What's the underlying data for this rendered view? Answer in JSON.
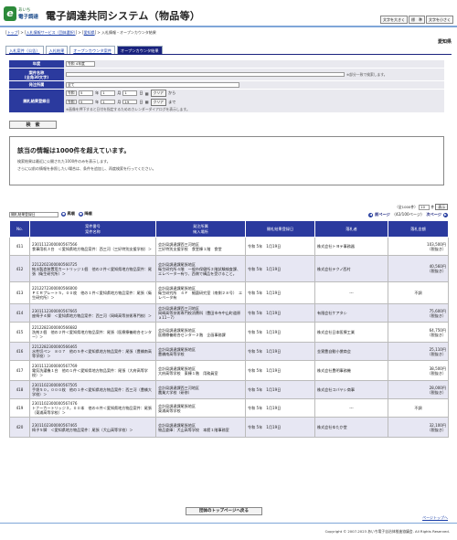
{
  "header": {
    "logo_top": "あいち",
    "logo_bottom": "電子調達",
    "title": "電子調達共同システム（物品等）",
    "font_buttons": [
      "文字を大きく",
      "標　準",
      "文字を小さく"
    ]
  },
  "breadcrumb": {
    "items": [
      "トップ",
      "入札情報サービス（団体選択）",
      "愛知県"
    ],
    "current": "入札情報・オープンカウンタ結果"
  },
  "region": "愛知県",
  "tabs": [
    "入札案件（公告）",
    "入札結果",
    "オープンカウンタ案件",
    "オープンカウンタ結果"
  ],
  "form": {
    "year_label": "年度",
    "year_value": "令和 4年度",
    "case_label": "案件名称\n(全角30文字)",
    "case_note": "※部分一致で検索します。",
    "org_label": "発注所属",
    "org_value": "全て",
    "date_label": "開札結果登録日",
    "date_from": [
      "令和",
      "5",
      "1",
      "1"
    ],
    "date_to": [
      "令和",
      "5",
      "1",
      "19"
    ],
    "date_units": [
      "年",
      "月",
      "日"
    ],
    "clear": "クリア",
    "from_suffix": "から",
    "to_suffix": "まで",
    "cal_note": "※画像を押下すると日付を指定するためのカレンダーダイアログを表示します。",
    "search_button": "検　索"
  },
  "message": {
    "title": "該当の情報は1000件を超えています。",
    "line1": "検索結果は最近に公開された1000件のみを表示します。",
    "line2": "さらに以前の情報を参照したい場合は、条件を追加し、再度検索を行ってください。"
  },
  "controls": {
    "total": "（全1000件）",
    "per_page": "10",
    "per_page_unit": "件",
    "display": "表示",
    "sort_value": "開札結果登録日",
    "asc": "昇順",
    "desc": "降順",
    "prev": "前ページ",
    "page_info": "（42/100ページ）",
    "next": "次ページ"
  },
  "table": {
    "headers": [
      "No.",
      "案件番号\n案件名称",
      "発注所属\n納入場所",
      "開札結果登録日",
      "落札者",
      "落札金額"
    ],
    "rows": [
      {
        "no": "411",
        "num": "2301112300000567566",
        "name": "食事用机３台　＜愛知県地方物品案件：西三河（三好特別支援学校）＞",
        "org": "会計局調達課西三河地区\n三好特別支援学校　食堂棟１階　食堂",
        "date": "令和 5年　1月19日",
        "winner": "株式会社トヨテ事務器",
        "price": "103,500円",
        "tax": "（税抜き）"
      },
      {
        "no": "412",
        "num": "2212202300000560725",
        "name": "純水製造装置用カートリッジ１個　他の２件＜愛知県地方物品案件：尾張（衛生研究所）＞",
        "org": "会計局調達課尾張地区\n衛生研究所４階　一般市保健所２階試験検査課、エレベーター有り、西側で構品を受けること。",
        "date": "令和 5年　1月19日",
        "winner": "株式会社テクノ西村",
        "price": "40,560円",
        "tax": "（税抜き）"
      },
      {
        "no": "413",
        "num": "2212272300000566000",
        "name": "ＰＣＲプレート５，００枚　他の１件＜愛知県地方物品案件：尾張（衛生研究所）＞",
        "org": "会計局調達課尾張地区\n衛生研究所　４Ｆ　細菌研究室（南側２８号）　エレベータ有",
        "date": "令和 5年　1月19日",
        "winner": "---",
        "price": "不調",
        "tax": ""
      },
      {
        "no": "414",
        "num": "2301112300000567665",
        "name": "座椅子４脚　＜愛知県地方物品案件：西三河（岡崎高等技術専門校）＞",
        "org": "会計局調達課西三河地区\n岡崎高等技術専門校消費科（豊田市寺中山町道原ａ11－7）",
        "date": "令和 5年　1月19日",
        "winner": "有限会社ケアタシ",
        "price": "75,600円",
        "tax": "（税抜き）"
      },
      {
        "no": "415",
        "num": "2212282300000566682",
        "name": "洗剤２個　他の２件＜愛知県地方物品案件：尾張（医療療養総合センター）＞",
        "org": "会計局調達課尾張地区\n医療療養総合センター２階　企画事務課",
        "date": "令和 5年　1月19日",
        "winner": "株式会社日本医療工業",
        "price": "64,750円",
        "tax": "（税抜き）"
      },
      {
        "no": "416",
        "num": "2212282300000566465",
        "name": "水性切ペン　８０７　他の５件＜愛知県地方物品案件：尾張（豊橋南高等学校）＞",
        "org": "会計局調達課尾張地区\n豊橋南高等学校",
        "date": "令和 5年　1月19日",
        "winner": "金實豊自動小償商会",
        "price": "25,110円",
        "tax": "（税抜き）"
      },
      {
        "no": "417",
        "num": "2301112300000567769",
        "name": "電気洗濯機１台　他の１件＜愛知県地方物品案件：尾張（大府高等学校）＞",
        "org": "会計局調達課尾張地区\n大府高等学校　東棟１階　用務員室",
        "date": "令和 5年　1月19日",
        "winner": "株式会社豊明事務機",
        "price": "38,500円",
        "tax": "（税抜き）"
      },
      {
        "no": "418",
        "num": "2301102300000567505",
        "name": "手袋５０，０００枚　他の１件＜愛知県地方物品案件：西三河（豊橋大学校）＞",
        "org": "会計局調達課西三河地区\n農業大学校（研修）",
        "date": "令和 5年　1月19日",
        "winner": "株式会社コバヤシ商事",
        "price": "28,000円",
        "tax": "（税抜き）"
      },
      {
        "no": "419",
        "num": "2301102300000567476",
        "name": "トナーカートリッジ３，００本　他の６件＜愛知県地方物品案件：尾張（東浦高等学校）＞",
        "org": "会計局調達課尾張地区\n東浦高等学校",
        "date": "令和 5年　1月19日",
        "winner": "---",
        "price": "不調",
        "tax": ""
      },
      {
        "no": "420",
        "num": "2301102300000567465",
        "name": "椅子５脚　＜愛知県地方物品案件：尾張（犬山高等学校）＞",
        "org": "会計局調達課尾張地区\n物品倉庫：犬山高等学校　本館１階事務室",
        "date": "令和 5年　1月19日",
        "winner": "株式会社ゆたか堂",
        "price": "32,100円",
        "tax": "（税抜き）"
      }
    ]
  },
  "top_page_button": "団体のトップページへ戻る",
  "page_top_link": "ページトップへ",
  "footer": "Copyright © 2007-2023 あいち電子自治体推進協議会. All Rights Reserved."
}
